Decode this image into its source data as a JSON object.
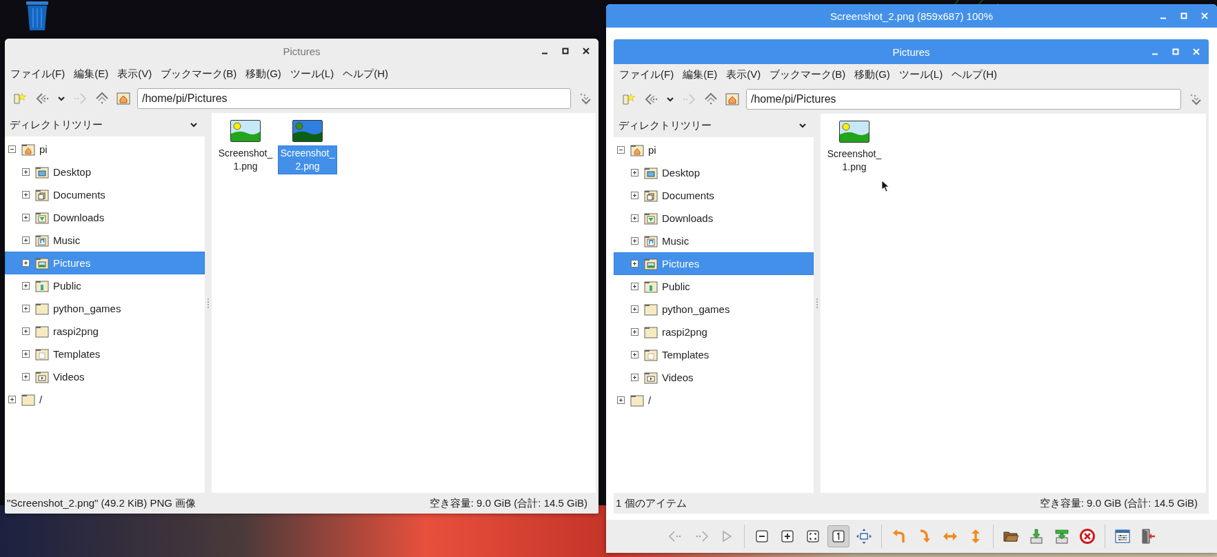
{
  "windows": [
    {
      "kind": "file_manager",
      "title": "Pictures",
      "active": false,
      "menu": [
        "ファイル(F)",
        "編集(E)",
        "表示(V)",
        "ブックマーク(B)",
        "移動(G)",
        "ツール(L)",
        "ヘルプ(H)"
      ],
      "path": "/home/pi/Pictures",
      "sidebar_title": "ディレクトリツリー",
      "tree": [
        {
          "label": "pi",
          "kind": "home",
          "expanded": true,
          "selected": false,
          "children": [
            {
              "label": "Desktop",
              "kind": "desktop",
              "expanded": false,
              "selected": false
            },
            {
              "label": "Documents",
              "kind": "documents",
              "expanded": false,
              "selected": false
            },
            {
              "label": "Downloads",
              "kind": "downloads",
              "expanded": false,
              "selected": false
            },
            {
              "label": "Music",
              "kind": "music",
              "expanded": false,
              "selected": false
            },
            {
              "label": "Pictures",
              "kind": "pictures",
              "expanded": false,
              "selected": true
            },
            {
              "label": "Public",
              "kind": "public",
              "expanded": false,
              "selected": false
            },
            {
              "label": "python_games",
              "kind": "plain",
              "expanded": false,
              "selected": false
            },
            {
              "label": "raspi2png",
              "kind": "plain",
              "expanded": false,
              "selected": false
            },
            {
              "label": "Templates",
              "kind": "templates",
              "expanded": false,
              "selected": false
            },
            {
              "label": "Videos",
              "kind": "videos",
              "expanded": false,
              "selected": false
            }
          ]
        },
        {
          "label": "/",
          "kind": "plain",
          "expanded": false,
          "selected": false
        }
      ],
      "files": [
        {
          "name": "Screenshot_1.png",
          "selected": false
        },
        {
          "name": "Screenshot_2.png",
          "selected": true
        }
      ],
      "status_left": "\"Screenshot_2.png\" (49.2 KiB) PNG 画像",
      "status_right": "空き容量: 9.0 GiB (合計: 14.5 GiB)"
    },
    {
      "kind": "image_viewer",
      "title": "Screenshot_2.png (859x687) 100%",
      "active": true,
      "image": {
        "kind": "file_manager",
        "title": "Pictures",
        "active": true,
        "menu": [
          "ファイル(F)",
          "編集(E)",
          "表示(V)",
          "ブックマーク(B)",
          "移動(G)",
          "ツール(L)",
          "ヘルプ(H)"
        ],
        "path": "/home/pi/Pictures",
        "sidebar_title": "ディレクトリツリー",
        "tree": [
          {
            "label": "pi",
            "kind": "home",
            "expanded": true,
            "selected": false,
            "children": [
              {
                "label": "Desktop",
                "kind": "desktop",
                "expanded": false,
                "selected": false
              },
              {
                "label": "Documents",
                "kind": "documents",
                "expanded": false,
                "selected": false
              },
              {
                "label": "Downloads",
                "kind": "downloads",
                "expanded": false,
                "selected": false
              },
              {
                "label": "Music",
                "kind": "music",
                "expanded": false,
                "selected": false
              },
              {
                "label": "Pictures",
                "kind": "pictures",
                "expanded": false,
                "selected": true
              },
              {
                "label": "Public",
                "kind": "public",
                "expanded": false,
                "selected": false
              },
              {
                "label": "python_games",
                "kind": "plain",
                "expanded": false,
                "selected": false
              },
              {
                "label": "raspi2png",
                "kind": "plain",
                "expanded": false,
                "selected": false
              },
              {
                "label": "Templates",
                "kind": "templates",
                "expanded": false,
                "selected": false
              },
              {
                "label": "Videos",
                "kind": "videos",
                "expanded": false,
                "selected": false
              }
            ]
          },
          {
            "label": "/",
            "kind": "plain",
            "expanded": false,
            "selected": false
          }
        ],
        "files": [
          {
            "name": "Screenshot_1.png",
            "selected": false
          }
        ],
        "status_left": "1 個のアイテム",
        "status_right": "空き容量: 9.0 GiB (合計: 14.5 GiB)"
      },
      "toolbar_groups": [
        [
          {
            "kind": "prev",
            "pressed": false
          },
          {
            "kind": "next",
            "pressed": false
          },
          {
            "kind": "play",
            "pressed": false
          }
        ],
        [
          {
            "kind": "zoom_out",
            "pressed": false
          },
          {
            "kind": "zoom_in",
            "pressed": false
          },
          {
            "kind": "fit",
            "pressed": false
          },
          {
            "kind": "original",
            "pressed": true
          },
          {
            "kind": "fullscreen",
            "pressed": false
          }
        ],
        [
          {
            "kind": "rotate_left",
            "pressed": false
          },
          {
            "kind": "rotate_right",
            "pressed": false
          },
          {
            "kind": "flip_h",
            "pressed": false
          },
          {
            "kind": "flip_v",
            "pressed": false
          }
        ],
        [
          {
            "kind": "open",
            "pressed": false
          },
          {
            "kind": "save",
            "pressed": false
          },
          {
            "kind": "save_as",
            "pressed": false
          },
          {
            "kind": "delete",
            "pressed": false
          }
        ],
        [
          {
            "kind": "preferences",
            "pressed": false
          },
          {
            "kind": "quit",
            "pressed": false
          }
        ]
      ]
    }
  ]
}
